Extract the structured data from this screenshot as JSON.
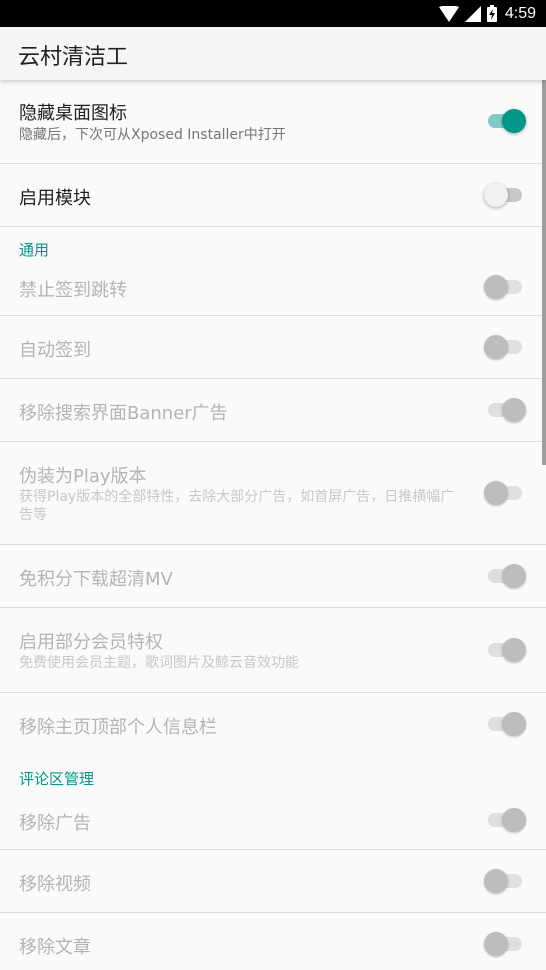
{
  "status_bar": {
    "time": "4:59",
    "icons": [
      "wifi-icon",
      "cell-signal-icon",
      "battery-icon"
    ]
  },
  "app_bar": {
    "title": "云村清洁工"
  },
  "colors": {
    "accent": "#009688",
    "accent_light": "#80cbc4",
    "text_primary": "#212121",
    "text_disabled": "#b4b4b4"
  },
  "prefs": {
    "hide_icon": {
      "title": "隐藏桌面图标",
      "summary": "隐藏后，下次可从Xposed Installer中打开",
      "checked": true
    },
    "enable_module": {
      "title": "启用模块",
      "checked": false
    }
  },
  "general": {
    "category": "通用",
    "items": [
      {
        "title": "禁止签到跳转",
        "checked": false
      },
      {
        "title": "自动签到",
        "checked": false
      },
      {
        "title": "移除搜索界面Banner广告",
        "checked": true
      },
      {
        "title": "伪装为Play版本",
        "summary": "获得Play版本的全部特性，去除大部分广告，如首屏广告，日推横幅广告等",
        "checked": false
      },
      {
        "title": "免积分下载超清MV",
        "checked": true
      },
      {
        "title": "启用部分会员特权",
        "summary": "免费使用会员主题，歌词图片及鲸云音效功能",
        "checked": true
      },
      {
        "title": "移除主页顶部个人信息栏",
        "checked": true
      }
    ]
  },
  "comments": {
    "category": "评论区管理",
    "items": [
      {
        "title": "移除广告",
        "checked": true
      },
      {
        "title": "移除视频",
        "checked": false
      },
      {
        "title": "移除文章",
        "checked": false
      }
    ]
  }
}
